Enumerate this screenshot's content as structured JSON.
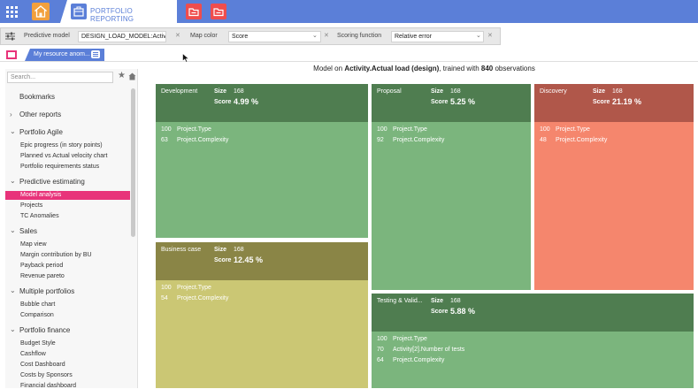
{
  "topbar": {
    "active_tab_label": "PORTFOLIO REPORTING"
  },
  "filters": {
    "predictive_model_label": "Predictive model",
    "predictive_model_value": "DESIGN_LOAD_MODEL:Activit",
    "map_color_label": "Map color",
    "map_color_value": "Score",
    "scoring_function_label": "Scoring function",
    "scoring_function_value": "Relative error"
  },
  "resource_tab": {
    "label": "My resource anom..."
  },
  "sidebar": {
    "search_placeholder": "Search...",
    "items": [
      {
        "label": "Bookmarks"
      },
      {
        "label": "Other reports"
      },
      {
        "label": "Portfolio Agile"
      },
      {
        "label": "Epic progress (in story points)"
      },
      {
        "label": "Planned vs Actual velocity chart"
      },
      {
        "label": "Portfolio requirements status"
      },
      {
        "label": "Predictive estimating"
      },
      {
        "label": "Model analysis"
      },
      {
        "label": "Projects"
      },
      {
        "label": "TC Anomalies"
      },
      {
        "label": "Sales"
      },
      {
        "label": "Map view"
      },
      {
        "label": "Margin contribution by BU"
      },
      {
        "label": "Payback period"
      },
      {
        "label": "Revenue pareto"
      },
      {
        "label": "Multiple portfolios"
      },
      {
        "label": "Bubble chart"
      },
      {
        "label": "Comparison"
      },
      {
        "label": "Portfolio finance"
      },
      {
        "label": "Budget Style"
      },
      {
        "label": "Cashflow"
      },
      {
        "label": "Cost Dashboard"
      },
      {
        "label": "Costs by Sponsors"
      },
      {
        "label": "Financial dashboard"
      }
    ]
  },
  "main": {
    "title_prefix": "Model on ",
    "title_target": "Activity.Actual load (design)",
    "title_middle": ", trained with ",
    "title_count": "840",
    "title_suffix": " observations"
  },
  "tiles": [
    {
      "name": "Development",
      "size_label": "Size",
      "size": "168",
      "score_label": "Score",
      "score": "4.99 %",
      "rows": [
        {
          "n": "100",
          "label": "Project.Type"
        },
        {
          "n": "63",
          "label": "Project.Complexity"
        }
      ],
      "head_color": "#4f7d50",
      "body_color": "#7bb57d"
    },
    {
      "name": "Proposal",
      "size_label": "Size",
      "size": "168",
      "score_label": "Score",
      "score": "5.25 %",
      "rows": [
        {
          "n": "100",
          "label": "Project.Type"
        },
        {
          "n": "92",
          "label": "Project.Complexity"
        }
      ],
      "head_color": "#4f7d50",
      "body_color": "#7bb57d"
    },
    {
      "name": "Discovery",
      "size_label": "Size",
      "size": "168",
      "score_label": "Score",
      "score": "21.19 %",
      "rows": [
        {
          "n": "100",
          "label": "Project.Type"
        },
        {
          "n": "48",
          "label": "Project.Complexity"
        }
      ],
      "head_color": "#b0574a",
      "body_color": "#f5866d"
    },
    {
      "name": "Business case",
      "size_label": "Size",
      "size": "168",
      "score_label": "Score",
      "score": "12.45 %",
      "rows": [
        {
          "n": "100",
          "label": "Project.Type"
        },
        {
          "n": "54",
          "label": "Project.Complexity"
        }
      ],
      "head_color": "#8a8546",
      "body_color": "#cbc774"
    },
    {
      "name": "Testing & Valid...",
      "size_label": "Size",
      "size": "168",
      "score_label": "Score",
      "score": "5.88 %",
      "rows": [
        {
          "n": "100",
          "label": "Project.Type"
        },
        {
          "n": "70",
          "label": "Activity[2].Number of tests"
        },
        {
          "n": "64",
          "label": "Project.Complexity"
        }
      ],
      "head_color": "#4f7d50",
      "body_color": "#7bb57d"
    }
  ]
}
